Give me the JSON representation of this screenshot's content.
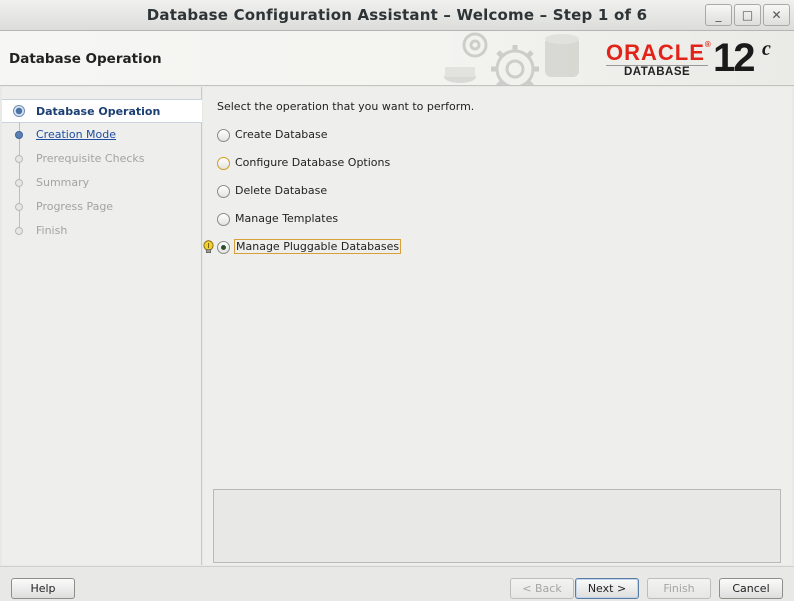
{
  "window": {
    "title": "Database Configuration Assistant – Welcome – Step 1 of 6",
    "controls": {
      "minimize": "_",
      "maximize": "□",
      "close": "✕"
    }
  },
  "header": {
    "page_title": "Database Operation",
    "logo": {
      "brand": "ORACLE",
      "brand_mark": "®",
      "product": "DATABASE",
      "version": "12",
      "version_suffix": "c"
    }
  },
  "nav": {
    "items": [
      {
        "label": "Database Operation",
        "state": "current"
      },
      {
        "label": "Creation Mode",
        "state": "link"
      },
      {
        "label": "Prerequisite Checks",
        "state": "disabled"
      },
      {
        "label": "Summary",
        "state": "disabled"
      },
      {
        "label": "Progress Page",
        "state": "disabled"
      },
      {
        "label": "Finish",
        "state": "disabled"
      }
    ]
  },
  "main": {
    "prompt": "Select the operation that you want to perform.",
    "options": [
      {
        "label": "Create Database",
        "mnemonic": "C",
        "checked": false
      },
      {
        "label": "Configure Database Options",
        "mnemonic": "o",
        "checked": false
      },
      {
        "label": "Delete Database",
        "mnemonic": "D",
        "checked": false
      },
      {
        "label": "Manage Templates",
        "mnemonic": "T",
        "checked": false
      },
      {
        "label": "Manage Pluggable Databases",
        "mnemonic": "g",
        "checked": true
      }
    ]
  },
  "buttons": {
    "help": "Help",
    "back": "< Back",
    "next": "Next >",
    "finish": "Finish",
    "cancel": "Cancel"
  },
  "colors": {
    "accent": "#1b3f73",
    "link": "#1f4ea1",
    "oracle_red": "#e2231a",
    "focus": "#d8a03a"
  }
}
